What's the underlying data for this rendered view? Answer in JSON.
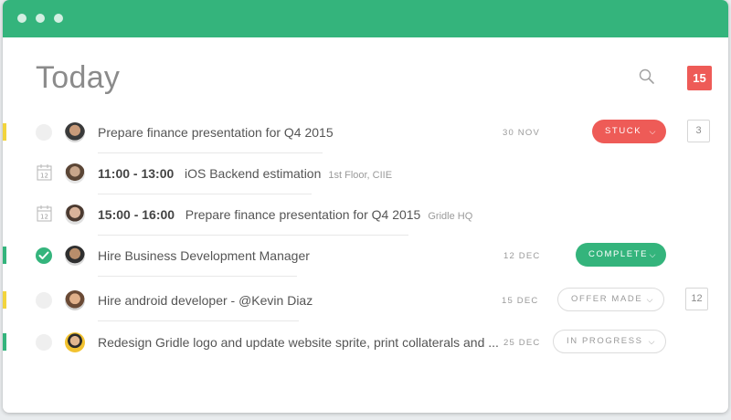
{
  "header": {
    "title": "Today",
    "date_badge": "15"
  },
  "icons": {
    "search": "search-icon",
    "calendar": "calendar-icon",
    "check": "check-icon",
    "chevron": "chevron-down-icon"
  },
  "colors": {
    "brand": "#34b47c",
    "stuck": "#ee5b57",
    "complete": "#34b47c",
    "yellow_flag": "#f2d43d",
    "green_flag": "#34b47c"
  },
  "tasks": [
    {
      "title": "Prepare finance presentation for Q4 2015",
      "date": "30 NOV",
      "status": "STUCK",
      "count": "3"
    },
    {
      "time": "11:00 - 13:00",
      "title": "iOS Backend estimation",
      "location": "1st Floor, CIIE",
      "calendar_day": "12"
    },
    {
      "time": "15:00 - 16:00",
      "title": "Prepare finance presentation for Q4 2015",
      "location": "Gridle HQ",
      "calendar_day": "12"
    },
    {
      "title": "Hire Business Development Manager",
      "date": "12 DEC",
      "status": "COMPLETE"
    },
    {
      "title": "Hire android developer - @Kevin Diaz",
      "date": "15 DEC",
      "status": "OFFER MADE",
      "count": "12"
    },
    {
      "title": "Redesign Gridle logo and update website sprite, print collaterals and ...",
      "date": "25 DEC",
      "status": "IN PROGRESS"
    }
  ]
}
